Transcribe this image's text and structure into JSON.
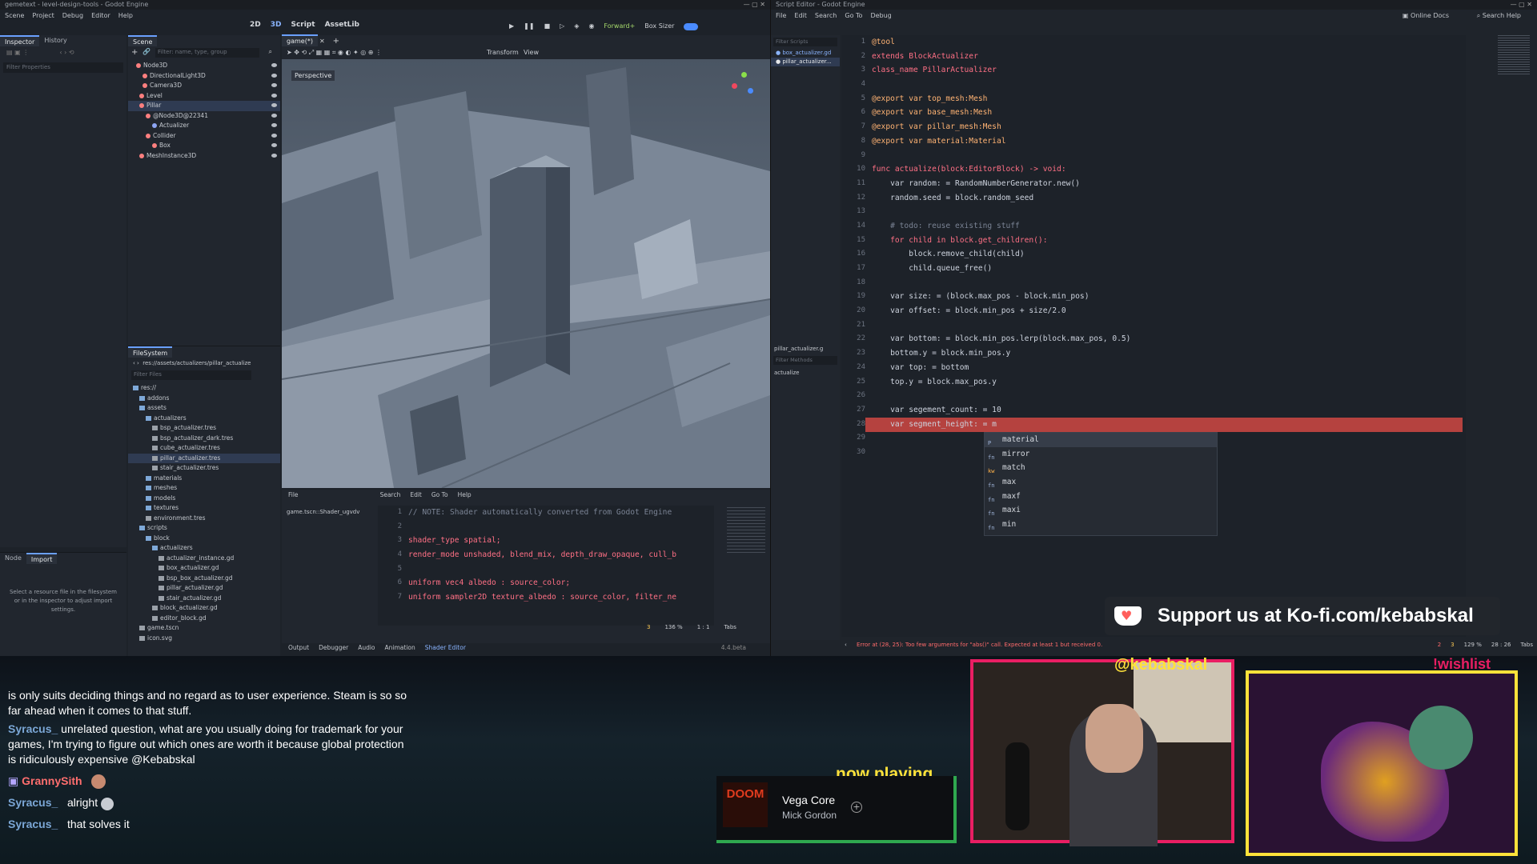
{
  "godot_main": {
    "title": "gemetext - level-design-tools - Godot Engine",
    "menu": [
      "Scene",
      "Project",
      "Debug",
      "Editor",
      "Help"
    ],
    "workspaces": [
      "2D",
      "3D",
      "Script",
      "AssetLib"
    ],
    "renderer": "Forward+",
    "box_sizer": "Box Sizer",
    "left_tabs": [
      "Inspector",
      "History"
    ],
    "filter_properties": "Filter Properties",
    "scene_tab": "Scene",
    "scene_filter": "Filter: name, type, group",
    "scene_tree": [
      "Node3D",
      "DirectionalLight3D",
      "Camera3D",
      "Level",
      "Pillar",
      "@Node3D@22341",
      "Actualizer",
      "Collider",
      "Box",
      "MeshInstance3D"
    ],
    "viewport_tab": "game(*)",
    "viewport_menus": [
      "Transform",
      "View"
    ],
    "perspective": "Perspective",
    "filesystem_tab": "FileSystem",
    "fs_path": "res://assets/actualizers/pillar_actualize",
    "fs_filter": "Filter Files",
    "fs_tree": [
      "res://",
      "addons",
      "assets",
      "actualizers",
      "bsp_actualizer.tres",
      "bsp_actualizer_dark.tres",
      "cube_actualizer.tres",
      "pillar_actualizer.tres",
      "stair_actualizer.tres",
      "materials",
      "meshes",
      "models",
      "textures",
      "environment.tres",
      "scripts",
      "block",
      "actualizers",
      "actualizer_instance.gd",
      "box_actualizer.gd",
      "bsp_box_actualizer.gd",
      "pillar_actualizer.gd",
      "stair_actualizer.gd",
      "block_actualizer.gd",
      "editor_block.gd",
      "game.tscn",
      "icon.svg"
    ],
    "node_tabs": [
      "Node",
      "Import"
    ],
    "import_hint": "Select a resource file in the filesystem or in the inspector to adjust import settings.",
    "shader_menu": [
      "File",
      "Search",
      "Edit",
      "Go To",
      "Help"
    ],
    "shader_file": "game.tscn::Shader_ugvdv",
    "shader_lines": [
      {
        "n": "1",
        "t": "// NOTE: Shader automatically converted from Godot Engine",
        "c": "cm"
      },
      {
        "n": "2",
        "t": "",
        "c": "ident"
      },
      {
        "n": "3",
        "t": "shader_type spatial;",
        "c": "ident"
      },
      {
        "n": "4",
        "t": "render_mode unshaded, blend_mix, depth_draw_opaque, cull_b",
        "c": "ident"
      },
      {
        "n": "5",
        "t": "",
        "c": "ident"
      },
      {
        "n": "6",
        "t": "uniform vec4 albedo : source_color;",
        "c": "ident"
      },
      {
        "n": "7",
        "t": "uniform sampler2D texture_albedo : source_color, filter_ne",
        "c": "ident"
      }
    ],
    "shader_status": [
      "3",
      "136 %",
      "1 : 1",
      "Tabs"
    ],
    "bottom_tabs": [
      "Output",
      "Debugger",
      "Audio",
      "Animation",
      "Shader Editor"
    ],
    "version": "4.4.beta"
  },
  "script_editor": {
    "title": "Script Editor - Godot Engine",
    "menu": [
      "File",
      "Edit",
      "Search",
      "Go To",
      "Debug"
    ],
    "right_links": [
      "Online Docs",
      "Search Help"
    ],
    "filter_scripts": "Filter Scripts",
    "open_scripts": [
      "box_actualizer.gd",
      "pillar_actualizer..."
    ],
    "methods_title": "pillar_actualizer.g",
    "filter_methods": "Filter Methods",
    "methods": [
      "actualize"
    ],
    "code": [
      "@tool",
      "extends BlockActualizer",
      "class_name PillarActualizer",
      "",
      "@export var top_mesh:Mesh",
      "@export var base_mesh:Mesh",
      "@export var pillar_mesh:Mesh",
      "@export var material:Material",
      "",
      "func actualize(block:EditorBlock) -> void:",
      "    var random: = RandomNumberGenerator.new()",
      "    random.seed = block.random_seed",
      "",
      "    # todo: reuse existing stuff",
      "    for child in block.get_children():",
      "        block.remove_child(child)",
      "        child.queue_free()",
      "",
      "    var size: = (block.max_pos - block.min_pos)",
      "    var offset: = block.min_pos + size/2.0",
      "",
      "    var bottom: = block.min_pos.lerp(block.max_pos, 0.5)",
      "    bottom.y = block.min_pos.y",
      "    var top: = bottom",
      "    top.y = block.max_pos.y",
      "",
      "    var segement_count: = 10",
      "    var segment_height: = m",
      "",
      ""
    ],
    "autocomplete": [
      {
        "icon": "P",
        "label": "material"
      },
      {
        "icon": "fn",
        "label": "mirror"
      },
      {
        "icon": "kw",
        "label": "match"
      },
      {
        "icon": "fn",
        "label": "max"
      },
      {
        "icon": "fn",
        "label": "maxf"
      },
      {
        "icon": "fn",
        "label": "maxi"
      },
      {
        "icon": "fn",
        "label": "min"
      }
    ],
    "error": "Error at (28, 25): Too few arguments for \"abs()\" call. Expected at least 1 but received 0.",
    "status": [
      "2",
      "3",
      "129 %",
      "28 : 26",
      "Tabs"
    ]
  },
  "stream": {
    "kofi": "Support us at Ko-fi.com/kebabskal",
    "handle": "@kebabskal",
    "wishlist": "!wishlist",
    "now_playing_label": "now playing",
    "track": "Vega Core",
    "artist": "Mick Gordon",
    "album_art": "DOOM",
    "chat": [
      {
        "user": "",
        "text": "is only suits deciding things and no regard as to user experience. Steam is so so far ahead when it comes to that stuff."
      },
      {
        "user": "Syracus_",
        "text": "unrelated question, what are you usually doing for trademark for your games, I'm trying to figure out which ones are worth it because global protection is ridiculously expensive @Kebabskal"
      },
      {
        "user": "GrannySith",
        "text": ""
      },
      {
        "user": "Syracus_",
        "text": "alright"
      },
      {
        "user": "Syracus_",
        "text": "that solves it"
      }
    ]
  },
  "colors": {
    "accent": "#4a8bff",
    "error_line": "#b5423f",
    "ui_bg": "#1d2229",
    "highlight": "#e91e63"
  }
}
